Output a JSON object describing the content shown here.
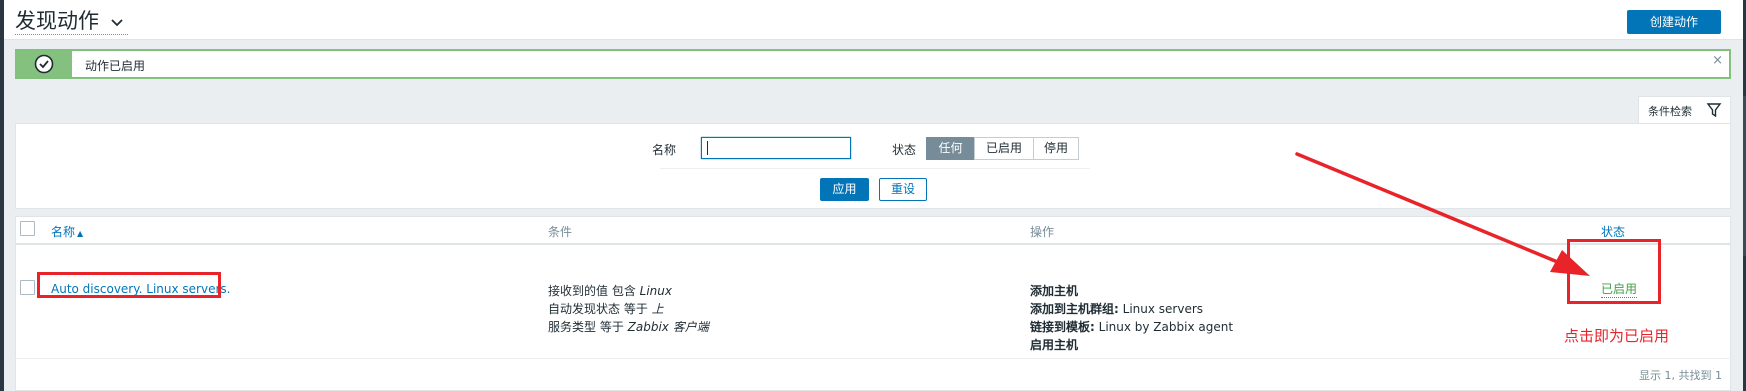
{
  "header": {
    "title": "发现动作",
    "create_button": "创建动作"
  },
  "message": {
    "text": "动作已启用",
    "close": "×"
  },
  "filter": {
    "tab_label": "条件检索",
    "name_label": "名称",
    "name_value": "",
    "status_label": "状态",
    "status_options": [
      "任何",
      "已启用",
      "停用"
    ],
    "status_selected": "任何",
    "apply": "应用",
    "reset": "重设"
  },
  "table": {
    "columns": {
      "name": "名称",
      "conditions": "条件",
      "operations": "操作",
      "status": "状态"
    },
    "rows": [
      {
        "name": "Auto discovery. Linux servers.",
        "conditions": [
          {
            "prefix": "接收到的值 包含 ",
            "value": "Linux"
          },
          {
            "prefix": "自动发现状态 等于 ",
            "value": "上"
          },
          {
            "prefix": "服务类型 等于 ",
            "value": "Zabbix 客户端"
          }
        ],
        "operations": [
          {
            "bold": "添加主机",
            "rest": ""
          },
          {
            "bold": "添加到主机群组:",
            "rest": " Linux servers"
          },
          {
            "bold": "链接到模板:",
            "rest": " Linux by Zabbix agent"
          },
          {
            "bold": "启用主机",
            "rest": ""
          }
        ],
        "status": "已启用"
      }
    ],
    "footer": "显示 1, 共找到 1"
  },
  "annotation": {
    "text": "点击即为已启用",
    "color": "#e8232a"
  },
  "colors": {
    "primary": "#0275b8",
    "success": "#429e47",
    "success_bg": "#85c17e"
  }
}
